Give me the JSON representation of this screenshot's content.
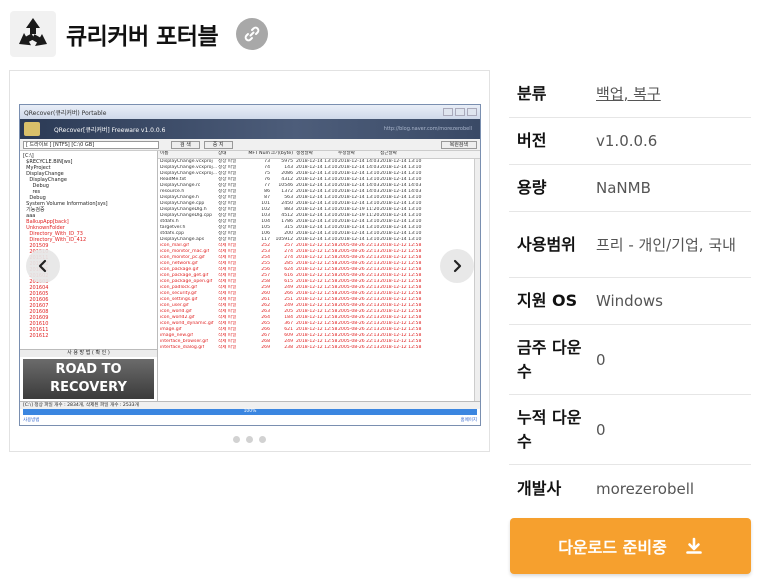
{
  "header": {
    "title": "큐리커버 포터블"
  },
  "gallery": {
    "app": {
      "window_title": "QRecover(큐리커버) Portable",
      "banner_title": "QRecover[큐리커버] Freeware v1.0.0.6",
      "banner_url": "http://blog.naver.com/morezerobell",
      "drive_select": "[ 드라이브 ] [NTFS] [C:\\0 GB]",
      "search_button": "검 색",
      "stop_button": "중 지",
      "recover_button": "복원검색",
      "tree": [
        {
          "text": "[C:\\]",
          "red": false
        },
        {
          "text": "  $RECYCLE.BIN[ws]",
          "red": false
        },
        {
          "text": "  MyProject",
          "red": false
        },
        {
          "text": "  DisplayChange",
          "red": false
        },
        {
          "text": "    DisplayChange",
          "red": false
        },
        {
          "text": "      Debug",
          "red": false
        },
        {
          "text": "      res",
          "red": false
        },
        {
          "text": "    Debug",
          "red": false
        },
        {
          "text": "  System Volume Information[sys]",
          "red": false
        },
        {
          "text": "  기능검증",
          "red": false
        },
        {
          "text": "  aaa",
          "red": false
        },
        {
          "text": "  BalkupApp[back]",
          "red": true
        },
        {
          "text": "  UnknownFolder",
          "red": true
        },
        {
          "text": "    Directory_With_ID_73",
          "red": true
        },
        {
          "text": "    Directory_With_ID_412",
          "red": true
        },
        {
          "text": "    201509",
          "red": true
        },
        {
          "text": "    201510",
          "red": true
        },
        {
          "text": "    201511",
          "red": true
        },
        {
          "text": "    201512",
          "red": true
        },
        {
          "text": "    201601",
          "red": true
        },
        {
          "text": "    201602",
          "red": true
        },
        {
          "text": "    201603",
          "red": true
        },
        {
          "text": "    201604",
          "red": true
        },
        {
          "text": "    201605",
          "red": true
        },
        {
          "text": "    201606",
          "red": true
        },
        {
          "text": "    201607",
          "red": true
        },
        {
          "text": "    201608",
          "red": true
        },
        {
          "text": "    201609",
          "red": true
        },
        {
          "text": "    201610",
          "red": true
        },
        {
          "text": "    201611",
          "red": true
        },
        {
          "text": "    201612",
          "red": true
        }
      ],
      "tree_caption": "사 용 방 법  ( 확 인 )",
      "tree_image_text_1": "ROAD TO",
      "tree_image_text_2": "RECOVERY",
      "columns": [
        "이름",
        "상태",
        "MFT Num",
        "크기(byte)",
        "생성날짜",
        "수정날짜",
        "접근날짜"
      ],
      "rows": [
        {
          "name": "DisplayChange.vcxproj",
          "state": "정상 파일",
          "mft": "73",
          "size": "5975",
          "c": "2018-12-14 13:10",
          "m": "2018-12-14 14:03",
          "a": "2018-12-14 13:10",
          "red": false
        },
        {
          "name": "DisplayChange.vcxproj...",
          "state": "정상 파일",
          "mft": "74",
          "size": "143",
          "c": "2018-12-14 13:10",
          "m": "2018-12-14 14:03",
          "a": "2018-12-14 13:10",
          "red": false
        },
        {
          "name": "DisplayChange.vcxproj...",
          "state": "정상 파일",
          "mft": "75",
          "size": "2086",
          "c": "2018-12-14 13:10",
          "m": "2018-12-14 13:10",
          "a": "2018-12-14 13:10",
          "red": false
        },
        {
          "name": "ReadMe.txt",
          "state": "정상 파일",
          "mft": "76",
          "size": "4312",
          "c": "2018-12-14 13:10",
          "m": "2018-12-14 13:10",
          "a": "2018-12-14 13:10",
          "red": false
        },
        {
          "name": "DisplayChange.rc",
          "state": "정상 파일",
          "mft": "77",
          "size": "10546",
          "c": "2018-12-14 13:10",
          "m": "2018-12-14 14:03",
          "a": "2018-12-14 14:03",
          "red": false
        },
        {
          "name": "resource.h",
          "state": "정상 파일",
          "mft": "86",
          "size": "1372",
          "c": "2018-12-14 13:10",
          "m": "2018-12-14 14:03",
          "a": "2018-12-14 14:03",
          "red": false
        },
        {
          "name": "DisplayChange.h",
          "state": "정상 파일",
          "mft": "87",
          "size": "563",
          "c": "2018-12-14 13:10",
          "m": "2018-12-14 13:10",
          "a": "2018-12-14 13:10",
          "red": false
        },
        {
          "name": "DisplayChange.cpp",
          "state": "정상 파일",
          "mft": "101",
          "size": "2450",
          "c": "2018-12-14 13:10",
          "m": "2018-12-14 13:10",
          "a": "2018-12-14 13:10",
          "red": false
        },
        {
          "name": "DisplayChangeDlg.h",
          "state": "정상 파일",
          "mft": "102",
          "size": "883",
          "c": "2018-12-14 13:10",
          "m": "2018-12-19 11:20",
          "a": "2018-12-14 13:10",
          "red": false
        },
        {
          "name": "DisplayChangeDlg.cpp",
          "state": "정상 파일",
          "mft": "103",
          "size": "4512",
          "c": "2018-12-14 13:10",
          "m": "2018-12-19 11:20",
          "a": "2018-12-14 13:10",
          "red": false
        },
        {
          "name": "stdafx.h",
          "state": "정상 파일",
          "mft": "104",
          "size": "1786",
          "c": "2018-12-14 13:10",
          "m": "2018-12-14 13:10",
          "a": "2018-12-14 13:10",
          "red": false
        },
        {
          "name": "targetver.h",
          "state": "정상 파일",
          "mft": "105",
          "size": "315",
          "c": "2018-12-14 13:10",
          "m": "2018-12-14 13:10",
          "a": "2018-12-14 13:10",
          "red": false
        },
        {
          "name": "stdafx.cpp",
          "state": "정상 파일",
          "mft": "106",
          "size": "200",
          "c": "2018-12-14 13:10",
          "m": "2018-12-14 13:10",
          "a": "2018-12-14 13:10",
          "red": false
        },
        {
          "name": "DisplayChange.aps",
          "state": "정상 파일",
          "mft": "117",
          "size": "105912",
          "c": "2018-12-14 13:10",
          "m": "2018-12-14 13:10",
          "a": "2018-12-14 13:10",
          "red": false
        },
        {
          "name": "icon_mail.gif",
          "state": "삭제 파일",
          "mft": "252",
          "size": "257",
          "c": "2018-12-12 12:58",
          "m": "2005-08-26 22:13",
          "a": "2018-12-12 12:58",
          "red": true
        },
        {
          "name": "icon_monitor_mac.gif",
          "state": "삭제 파일",
          "mft": "253",
          "size": "274",
          "c": "2018-12-12 12:58",
          "m": "2005-08-26 22:13",
          "a": "2018-12-12 12:58",
          "red": true
        },
        {
          "name": "icon_monitor_pc.gif",
          "state": "삭제 파일",
          "mft": "254",
          "size": "274",
          "c": "2018-12-12 12:58",
          "m": "2005-08-26 22:13",
          "a": "2018-12-12 12:58",
          "red": true
        },
        {
          "name": "icon_network.gif",
          "state": "삭제 파일",
          "mft": "255",
          "size": "285",
          "c": "2018-12-12 12:58",
          "m": "2005-08-26 22:13",
          "a": "2018-12-12 12:58",
          "red": true
        },
        {
          "name": "icon_package.gif",
          "state": "삭제 파일",
          "mft": "256",
          "size": "624",
          "c": "2018-12-12 12:58",
          "m": "2005-08-26 22:13",
          "a": "2018-12-12 12:58",
          "red": true
        },
        {
          "name": "icon_package_get.gif",
          "state": "삭제 파일",
          "mft": "257",
          "size": "616",
          "c": "2018-12-12 12:58",
          "m": "2005-08-26 22:13",
          "a": "2018-12-12 12:58",
          "red": true
        },
        {
          "name": "icon_package_open.gif",
          "state": "삭제 파일",
          "mft": "258",
          "size": "615",
          "c": "2018-12-12 12:58",
          "m": "2005-08-26 22:13",
          "a": "2018-12-12 12:58",
          "red": true
        },
        {
          "name": "icon_padlock.gif",
          "state": "삭제 파일",
          "mft": "259",
          "size": "249",
          "c": "2018-12-12 12:58",
          "m": "2005-08-26 22:13",
          "a": "2018-12-12 12:58",
          "red": true
        },
        {
          "name": "icon_security.gif",
          "state": "삭제 파일",
          "mft": "260",
          "size": "266",
          "c": "2018-12-12 12:58",
          "m": "2005-08-26 22:13",
          "a": "2018-12-12 12:58",
          "red": true
        },
        {
          "name": "icon_settings.gif",
          "state": "삭제 파일",
          "mft": "261",
          "size": "251",
          "c": "2018-12-12 12:58",
          "m": "2005-08-26 22:13",
          "a": "2018-12-12 12:58",
          "red": true
        },
        {
          "name": "icon_user.gif",
          "state": "삭제 파일",
          "mft": "262",
          "size": "249",
          "c": "2018-12-12 12:58",
          "m": "2005-08-26 22:13",
          "a": "2018-12-12 12:58",
          "red": true
        },
        {
          "name": "icon_world.gif",
          "state": "삭제 파일",
          "mft": "263",
          "size": "205",
          "c": "2018-12-12 12:58",
          "m": "2005-08-26 22:13",
          "a": "2018-12-12 12:58",
          "red": true
        },
        {
          "name": "icon_world2.gif",
          "state": "삭제 파일",
          "mft": "264",
          "size": "184",
          "c": "2018-12-12 12:58",
          "m": "2005-08-26 22:13",
          "a": "2018-12-12 12:58",
          "red": true
        },
        {
          "name": "icon_world_dynamic.gif",
          "state": "삭제 파일",
          "mft": "265",
          "size": "367",
          "c": "2018-12-12 12:58",
          "m": "2005-08-26 22:13",
          "a": "2018-12-12 12:58",
          "red": true
        },
        {
          "name": "image.gif",
          "state": "삭제 파일",
          "mft": "266",
          "size": "621",
          "c": "2018-12-12 12:58",
          "m": "2005-08-26 22:13",
          "a": "2018-12-12 12:58",
          "red": true
        },
        {
          "name": "image_new.gif",
          "state": "삭제 파일",
          "mft": "267",
          "size": "609",
          "c": "2018-12-12 12:58",
          "m": "2005-08-26 22:13",
          "a": "2018-12-12 12:58",
          "red": true
        },
        {
          "name": "interface_browser.gif",
          "state": "삭제 파일",
          "mft": "268",
          "size": "249",
          "c": "2018-12-12 12:58",
          "m": "2005-08-26 22:13",
          "a": "2018-12-12 12:58",
          "red": true
        },
        {
          "name": "interface_dialog.gif",
          "state": "삭제 파일",
          "mft": "269",
          "size": "238",
          "c": "2018-12-12 12:58",
          "m": "2005-08-26 22:13",
          "a": "2018-12-12 12:58",
          "red": true
        }
      ],
      "status_text": "[C:\\] 정상 파일 개수 : 2834개, 삭제된 파일 개수 : 2533개",
      "progress_text": "100%",
      "progress": 100,
      "footer_left": "사용방법",
      "footer_right": "홈페이지"
    }
  },
  "info": {
    "rows": [
      {
        "key": "분류",
        "value": "백업, 복구",
        "link": true
      },
      {
        "key": "버전",
        "value": "v1.0.0.6",
        "link": false
      },
      {
        "key": "용량",
        "value": "NaNMB",
        "link": false
      },
      {
        "key": "사용범위",
        "value": "프리 - 개인/기업, 국내",
        "link": false
      },
      {
        "key": "지원 OS",
        "value": "Windows",
        "link": false
      },
      {
        "key": "금주 다운수",
        "value": "0",
        "link": false
      },
      {
        "key": "누적 다운수",
        "value": "0",
        "link": false
      },
      {
        "key": "개발사",
        "value": "morezerobell",
        "link": false
      }
    ]
  },
  "download": {
    "label": "다운로드 준비중"
  },
  "colors": {
    "accent": "#f6a02e",
    "deleted_file": "#e02020"
  }
}
